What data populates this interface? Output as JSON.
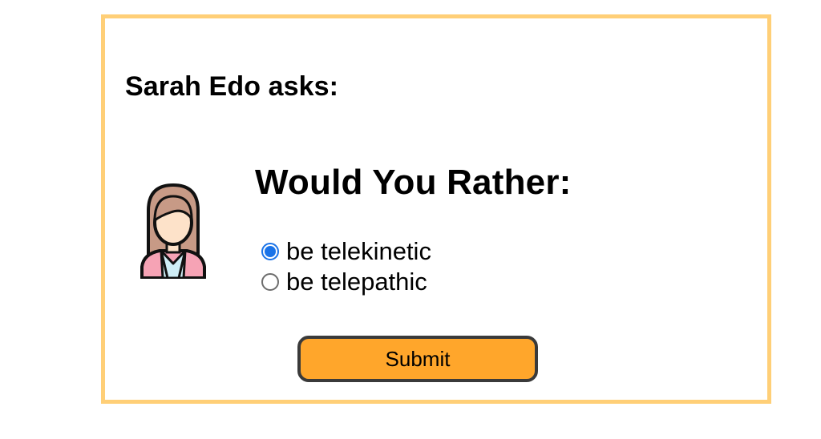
{
  "poll": {
    "asker_line": "Sarah Edo asks:",
    "avatar_icon": "woman-avatar-icon",
    "question_title": "Would You Rather:",
    "options": [
      {
        "label": "be telekinetic",
        "selected": true
      },
      {
        "label": "be telepathic",
        "selected": false
      }
    ],
    "submit_label": "Submit"
  },
  "colors": {
    "card_border": "#ffcf77",
    "submit_background": "#ffa62b",
    "radio_selected": "#1a73e8"
  }
}
